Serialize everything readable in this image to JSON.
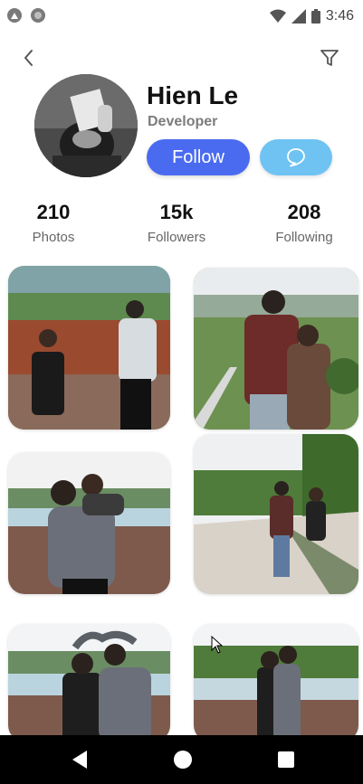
{
  "status_bar": {
    "time": "3:46",
    "icons": [
      "android-a-icon",
      "circle-app-icon",
      "wifi-icon",
      "signal-icon",
      "battery-icon"
    ]
  },
  "top_bar": {
    "back_icon": "chevron-left-icon",
    "filter_icon": "filter-icon"
  },
  "profile": {
    "name": "Hien Le",
    "role": "Developer",
    "follow_label": "Follow",
    "message_icon": "chat-bubble-icon"
  },
  "stats": [
    {
      "value": "210",
      "label": "Photos"
    },
    {
      "value": "15k",
      "label": "Followers"
    },
    {
      "value": "208",
      "label": "Following"
    }
  ],
  "photos": [
    {
      "scene": "couple-field-sky-reddish"
    },
    {
      "scene": "couple-back-view-hills"
    },
    {
      "scene": "piggyback-lake"
    },
    {
      "scene": "couple-walking-road"
    },
    {
      "scene": "heart-hands-lake"
    },
    {
      "scene": "couple-kiss-lake"
    }
  ],
  "colors": {
    "follow_button": "#4a6bf0",
    "message_button": "#6fc3f3",
    "navbar": "#000000"
  }
}
